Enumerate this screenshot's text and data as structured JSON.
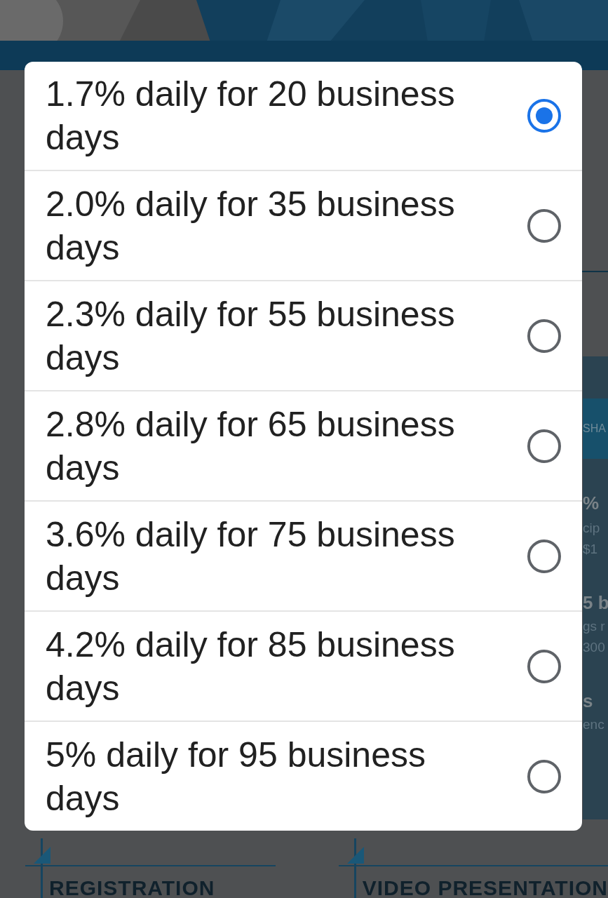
{
  "background": {
    "side_fragments": [
      {
        "kind": "badge",
        "text": "SHA"
      },
      {
        "kind": "heading",
        "text": "%"
      },
      {
        "kind": "text",
        "text": "cip"
      },
      {
        "kind": "text",
        "text": "$1"
      },
      {
        "kind": "heading",
        "text": "5 b"
      },
      {
        "kind": "text",
        "text": "gs r"
      },
      {
        "kind": "text",
        "text": "300"
      },
      {
        "kind": "heading",
        "text": "s"
      },
      {
        "kind": "text",
        "text": "enc"
      }
    ],
    "sections": [
      {
        "title": "REGISTRATION"
      },
      {
        "title": "VIDEO PRESENTATION"
      }
    ]
  },
  "dialog": {
    "options": [
      {
        "label": "1.7% daily for 20 business days",
        "selected": true
      },
      {
        "label": "2.0% daily for 35 business days",
        "selected": false
      },
      {
        "label": "2.3% daily for 55 business days",
        "selected": false
      },
      {
        "label": "2.8% daily for 65 business days",
        "selected": false
      },
      {
        "label": "3.6% daily for 75 business days",
        "selected": false
      },
      {
        "label": "4.2% daily for 85 business days",
        "selected": false
      },
      {
        "label": "5% daily for 95 business days",
        "selected": false
      }
    ]
  }
}
